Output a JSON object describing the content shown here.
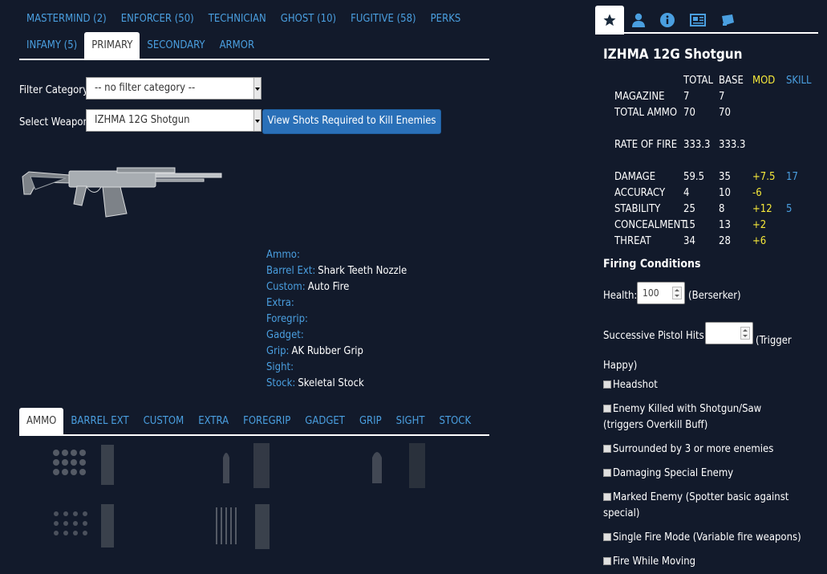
{
  "skill_tabs_row1": [
    "MASTERMIND (2)",
    "ENFORCER (50)",
    "TECHNICIAN",
    "GHOST (10)",
    "FUGITIVE (58)",
    "PERKS"
  ],
  "skill_tabs_row2": [
    "INFAMY (5)",
    "PRIMARY",
    "SECONDARY",
    "ARMOR"
  ],
  "filter": {
    "label": "Filter Category:",
    "value": "-- no filter category --"
  },
  "weapon_select": {
    "label": "Select Weapon:",
    "value": "IZHMA 12G Shotgun",
    "button": "View Shots Required to Kill Enemies"
  },
  "mods": [
    {
      "key": "Ammo:",
      "value": ""
    },
    {
      "key": "Barrel Ext:",
      "value": "Shark Teeth Nozzle"
    },
    {
      "key": "Custom:",
      "value": "Auto Fire"
    },
    {
      "key": "Extra:",
      "value": ""
    },
    {
      "key": "Foregrip:",
      "value": ""
    },
    {
      "key": "Gadget:",
      "value": ""
    },
    {
      "key": "Grip:",
      "value": "AK Rubber Grip"
    },
    {
      "key": "Sight:",
      "value": ""
    },
    {
      "key": "Stock:",
      "value": "Skeletal Stock"
    }
  ],
  "mod_tabs": [
    "AMMO",
    "BARREL EXT",
    "CUSTOM",
    "EXTRA",
    "FOREGRIP",
    "GADGET",
    "GRIP",
    "SIGHT",
    "STOCK"
  ],
  "right_panel": {
    "tab_icons": [
      "star-icon",
      "user-icon",
      "info-icon",
      "newspaper-icon",
      "ticket-icon"
    ],
    "title": "IZHMA 12G Shotgun",
    "headers": {
      "total": "TOTAL",
      "base": "BASE",
      "mod": "MOD",
      "skill": "SKILL"
    },
    "stats": [
      {
        "name": "MAGAZINE",
        "total": "7",
        "base": "7",
        "mod": "",
        "skill": ""
      },
      {
        "name": "TOTAL AMMO",
        "total": "70",
        "base": "70",
        "mod": "",
        "skill": ""
      },
      {
        "name": "RATE OF FIRE",
        "total": "333.3",
        "base": "333.3",
        "mod": "",
        "skill": ""
      },
      {
        "name": "DAMAGE",
        "total": "59.5",
        "base": "35",
        "mod": "+7.5",
        "skill": "17"
      },
      {
        "name": "ACCURACY",
        "total": "4",
        "base": "10",
        "mod": "-6",
        "skill": ""
      },
      {
        "name": "STABILITY",
        "total": "25",
        "base": "8",
        "mod": "+12",
        "skill": "5"
      },
      {
        "name": "CONCEALMENT",
        "total": "15",
        "base": "13",
        "mod": "+2",
        "skill": ""
      },
      {
        "name": "THREAT",
        "total": "34",
        "base": "28",
        "mod": "+6",
        "skill": ""
      }
    ],
    "firing_conditions": "Firing Conditions",
    "health_label": "Health:",
    "health_value": "100",
    "health_suffix": "(Berserker)",
    "pistol_label": "Successive Pistol Hits:",
    "pistol_value": "",
    "pistol_suffix": "(Trigger Happy)",
    "conditions": [
      "Headshot",
      "Enemy Killed with Shotgun/Saw (triggers Overkill Buff)",
      "Surrounded by 3 or more enemies",
      "Damaging Special Enemy",
      "Marked Enemy (Spotter basic against special)",
      "Single Fire Mode (Variable fire weapons)",
      "Fire While Moving"
    ]
  }
}
